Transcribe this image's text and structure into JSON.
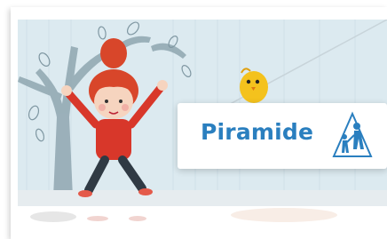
{
  "brand": {
    "name": "Piramide",
    "accent_color": "#2a7fbf",
    "logo_icon": "pyramid-logo-icon"
  },
  "illustration": {
    "subjects": [
      "girl-figure",
      "yellow-bird",
      "tree"
    ]
  }
}
